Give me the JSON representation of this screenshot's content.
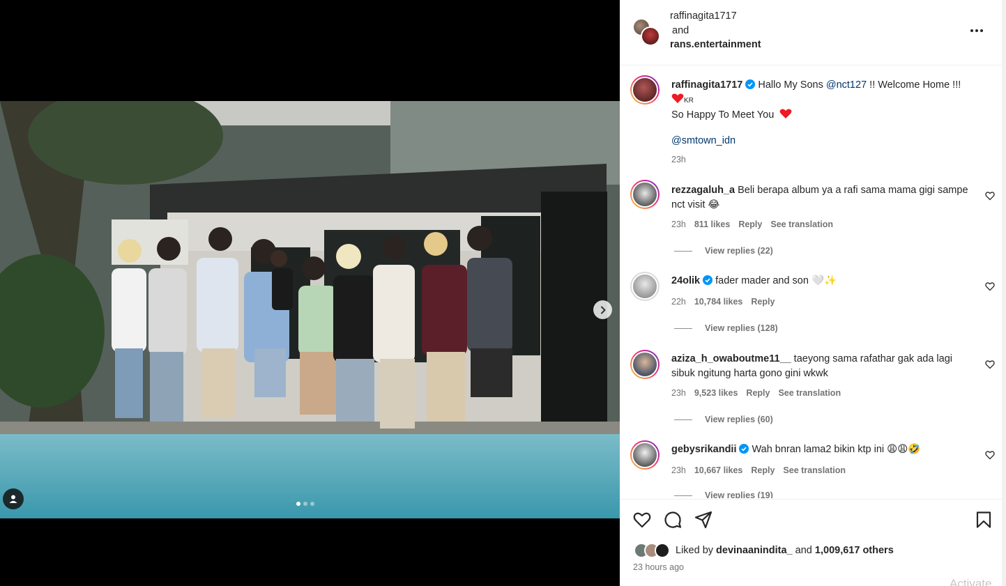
{
  "post": {
    "owner": "raffinagita1717",
    "and_text": "and",
    "collaborator": "rans.entertainment",
    "menu_icon": "more-horizontal-icon",
    "carousel": {
      "current": 1,
      "total": 3
    }
  },
  "caption": {
    "username": "raffinagita1717",
    "text_1": "Hallo My Sons",
    "mention_1": "@nct127",
    "text_2": "!! Welcome Home !!!",
    "kr": "KR",
    "line_2": "So Happy To Meet You",
    "mention_2": "@smtown_idn",
    "time": "23h"
  },
  "comments": [
    {
      "username": "rezzagaluh_a",
      "verified": false,
      "text": "Beli berapa album ya a rafi sama mama gigi sampe nct visit 😂",
      "time": "23h",
      "likes": "811 likes",
      "reply": "Reply",
      "translate": "See translation",
      "view_replies": "View replies (22)"
    },
    {
      "username": "24olik",
      "verified": true,
      "text": "fader mader and son 🤍✨",
      "time": "22h",
      "likes": "10,784 likes",
      "reply": "Reply",
      "view_replies": "View replies (128)"
    },
    {
      "username": "aziza_h_owaboutme11__",
      "verified": false,
      "text": "taeyong sama rafathar gak ada lagi sibuk ngitung harta gono gini wkwk",
      "time": "23h",
      "likes": "9,523 likes",
      "reply": "Reply",
      "translate": "See translation",
      "view_replies": "View replies (60)"
    },
    {
      "username": "gebysrikandii",
      "verified": true,
      "text": "Wah bnran lama2 bikin ktp ini 😩😩🤣",
      "time": "23h",
      "likes": "10,667 likes",
      "reply": "Reply",
      "translate": "See translation",
      "view_replies": "View replies (19)"
    }
  ],
  "footer": {
    "liked_by": "Liked by",
    "liker": "devinaanindita_",
    "and": "and",
    "others": "1,009,617 others",
    "ago": "23 hours ago"
  },
  "watermark": "Activate",
  "colors": {
    "link": "#00376b",
    "verified": "#0095f6",
    "heart": "#ed1c24",
    "meta": "#737373"
  }
}
